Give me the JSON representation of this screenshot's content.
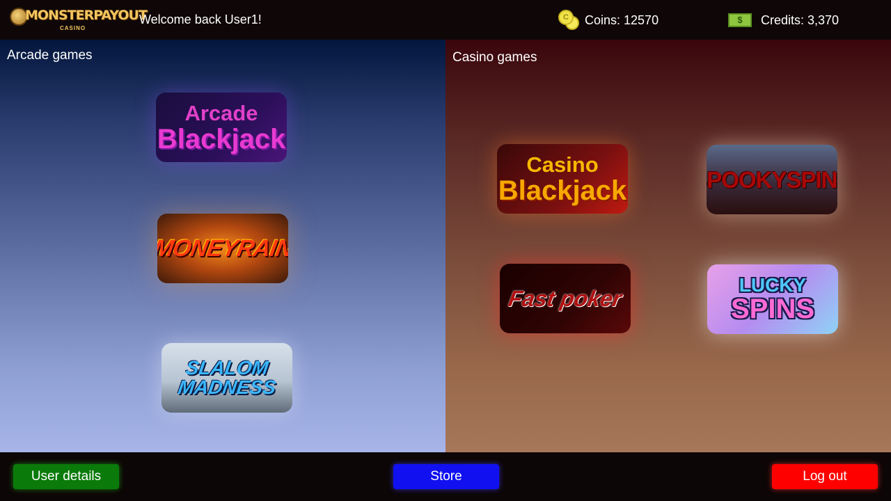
{
  "header": {
    "logo_text": "MONSTERPAYOUT",
    "logo_subtext": "CASINO",
    "welcome": "Welcome back User1!",
    "coins_label": "Coins: 12570",
    "coin_icon_glyph": "C",
    "credits_label": "Credits: 3,370",
    "cash_icon_glyph": "$"
  },
  "arcade": {
    "title": "Arcade games",
    "games": [
      {
        "line1": "Arcade",
        "line2": "Blackjack"
      },
      {
        "line1": "MONEYRAIN"
      },
      {
        "line1": "SLALOM",
        "line2": "MADNESS"
      }
    ]
  },
  "casino": {
    "title": "Casino games",
    "games": [
      {
        "line1": "Casino",
        "line2": "Blackjack"
      },
      {
        "line1": "SPOOKYSPINS"
      },
      {
        "line1": "Fast poker"
      },
      {
        "line1": "LUCKY",
        "line2": "SPINS"
      }
    ]
  },
  "footer": {
    "user_details": "User details",
    "store": "Store",
    "logout": "Log out"
  },
  "colors": {
    "user_details_button": "#0a7a0a",
    "store_button": "#1010f0",
    "logout_button": "#ff0000",
    "logo_gold": "#f2c560"
  }
}
